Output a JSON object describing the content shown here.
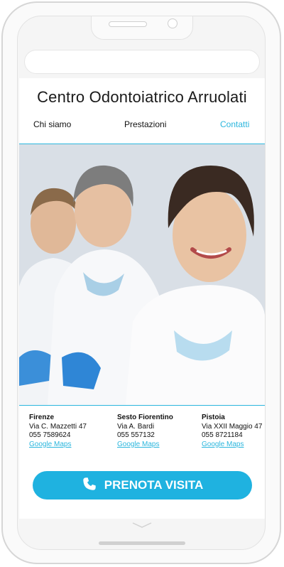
{
  "site": {
    "title": "Centro Odontoiatrico Arruolati",
    "nav": [
      {
        "label": "Chi siamo",
        "active": false
      },
      {
        "label": "Prestazioni",
        "active": false
      },
      {
        "label": "Contatti",
        "active": true
      }
    ]
  },
  "locations": [
    {
      "city": "Firenze",
      "address": "Via C. Mazzetti 47",
      "phone": "055 7589624",
      "map_link": "Google Maps"
    },
    {
      "city": "Sesto Fiorentino",
      "address": "Via A. Bardi",
      "phone": "055 557132",
      "map_link": "Google Maps"
    },
    {
      "city": "Pistoia",
      "address": "Via XXII Maggio 47",
      "phone": "055 8721184",
      "map_link": "Google Maps"
    }
  ],
  "cta": {
    "label": "PRENOTA VISITA",
    "icon": "phone-icon"
  },
  "colors": {
    "accent": "#2bb6dd",
    "button": "#1fb2e0"
  }
}
